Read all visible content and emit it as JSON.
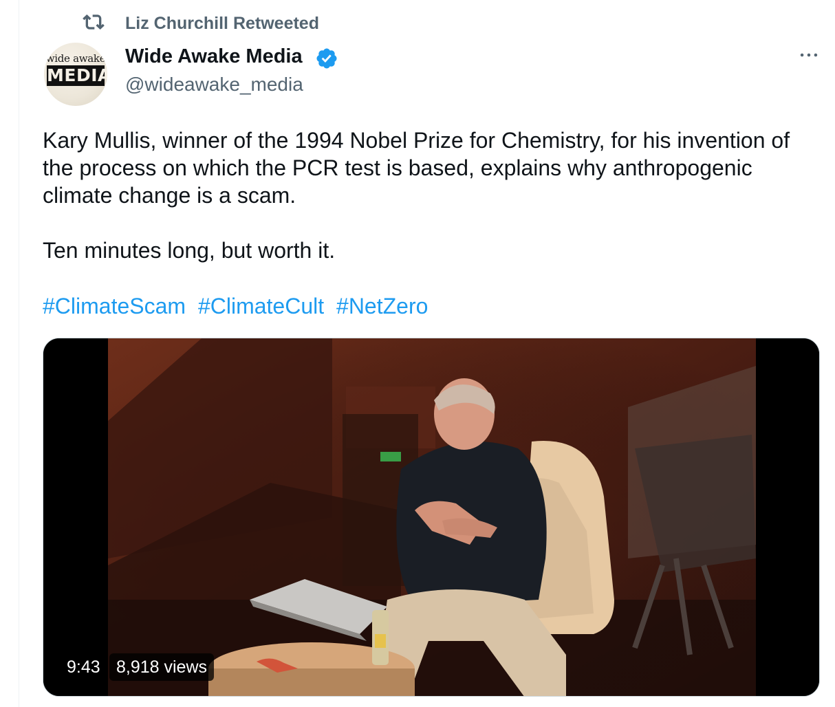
{
  "retweet": {
    "label": "Liz Churchill Retweeted",
    "icon": "retweet-icon"
  },
  "author": {
    "avatar": {
      "line1": "wide awake",
      "line2": "MEDIA"
    },
    "name": "Wide Awake Media",
    "verified_icon": "verified-badge-icon",
    "handle": "@wideawake_media"
  },
  "menu": {
    "icon": "more-options-icon"
  },
  "tweet": {
    "paragraph1": "Kary Mullis, winner of the 1994 Nobel Prize for Chemistry, for his invention of the process on which the PCR test is based, explains why anthropogenic climate change is a scam.",
    "paragraph2": "Ten minutes long, but worth it.",
    "hashtags": [
      "#ClimateScam",
      "#ClimateCult",
      "#NetZero"
    ]
  },
  "video": {
    "duration": "9:43",
    "views": "8,918 views"
  },
  "colors": {
    "accent": "#1d9bf0",
    "secondary_text": "#536471",
    "primary_text": "#0f1419"
  }
}
